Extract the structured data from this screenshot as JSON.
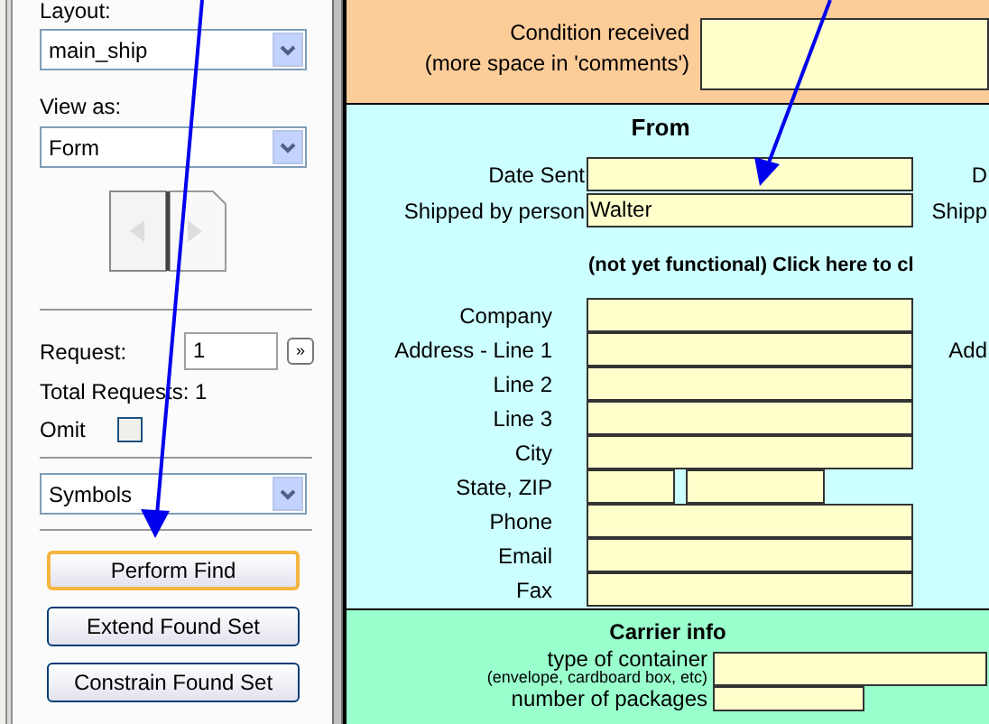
{
  "sidebar": {
    "layout_label": "Layout:",
    "layout_value": "main_ship",
    "view_label": "View as:",
    "view_value": "Form",
    "request_label": "Request:",
    "request_value": "1",
    "request_next": "»",
    "total_requests": "Total Requests: 1",
    "omit_label": "Omit",
    "omit_checked": false,
    "symbols_value": "Symbols",
    "buttons": [
      {
        "label": "Perform Find",
        "selected": true
      },
      {
        "label": "Extend Found Set",
        "selected": false
      },
      {
        "label": "Constrain Found Set",
        "selected": false
      }
    ]
  },
  "condition": {
    "label": "Condition received",
    "sublabel": "(more space in 'comments')"
  },
  "from": {
    "title": "From",
    "note": "(not yet functional) Click here to cl",
    "top_fields": [
      {
        "label": "Date Sent",
        "right_label": "D"
      },
      {
        "label": "Shipped by person",
        "value": "Walter",
        "right_label": "Shipp"
      }
    ],
    "address_fields": [
      {
        "label": "Company",
        "kind": "single"
      },
      {
        "label": "Address - Line 1",
        "kind": "single",
        "right_label": "Add"
      },
      {
        "label": "Line 2",
        "kind": "single"
      },
      {
        "label": "Line 3",
        "kind": "single"
      },
      {
        "label": "City",
        "kind": "single"
      },
      {
        "label": "State, ZIP",
        "kind": "pair"
      },
      {
        "label": "Phone",
        "kind": "single"
      },
      {
        "label": "Email",
        "kind": "single"
      },
      {
        "label": "Fax",
        "kind": "single"
      }
    ]
  },
  "carrier": {
    "title": "Carrier info",
    "container_label": "type of container",
    "container_hint": "(envelope, cardboard box, etc)",
    "packages_label": "number of packages"
  }
}
